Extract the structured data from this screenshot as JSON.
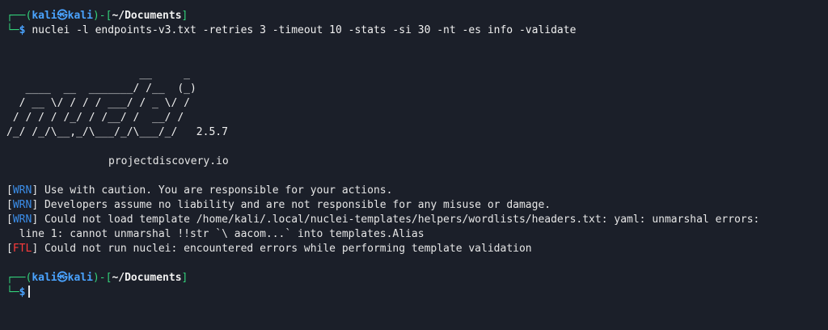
{
  "prompt": {
    "corner_top": "┌──(",
    "user": "kali",
    "at_symbol": "㉿",
    "host": "kali",
    "mid": ")-[",
    "path": "~/Documents",
    "close": "]",
    "corner_bottom": "└─",
    "dollar": "$"
  },
  "command": "nuclei -l endpoints-v3.txt -retries 3 -timeout 10 -stats -si 30 -nt -es info -validate",
  "banner": {
    "lines": [
      "                     __     _",
      "   ____  __  _______/ /__  (_)",
      "  / __ \\/ / / / ___/ / _ \\/ /",
      " / / / / /_/ / /__/ /  __/ /",
      "/_/ /_/\\__,_/\\___/_/\\___/_/   2.5.7"
    ],
    "site": "projectdiscovery.io"
  },
  "messages": [
    {
      "level": "WRN",
      "text": "Use with caution. You are responsible for your actions."
    },
    {
      "level": "WRN",
      "text": "Developers assume no liability and are not responsible for any misuse or damage."
    },
    {
      "level": "WRN",
      "text": "Could not load template /home/kali/.local/nuclei-templates/helpers/wordlists/headers.txt: yaml: unmarshal errors:"
    },
    {
      "level": "",
      "text": "  line 1: cannot unmarshal !!str `\\ aacom...` into templates.Alias"
    },
    {
      "level": "FTL",
      "text": "Could not run nuclei: encountered errors while performing template validation"
    }
  ],
  "colors": {
    "background": "#1b1f29",
    "prompt_frame": "#33d17a",
    "host_user": "#4aa3ff",
    "wrn": "#3b8eea",
    "ftl": "#ff3b3b"
  }
}
